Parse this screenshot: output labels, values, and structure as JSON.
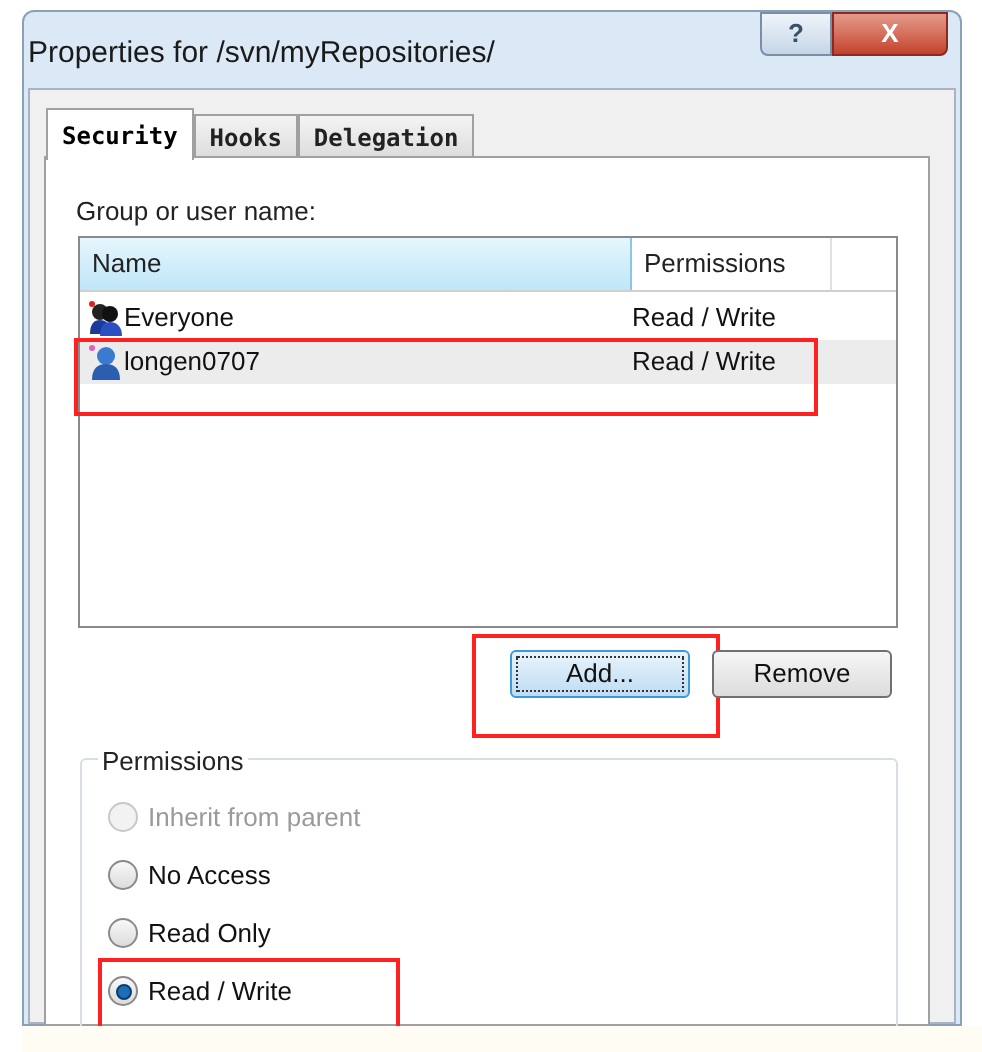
{
  "window": {
    "title": "Properties for /svn/myRepositories/",
    "buttons": [
      "?",
      "X"
    ]
  },
  "tabs": [
    {
      "label": "Security",
      "selected": true
    },
    {
      "label": "Hooks",
      "selected": false
    },
    {
      "label": "Delegation",
      "selected": false
    }
  ],
  "group_label": "Group or user name:",
  "table": {
    "columns": [
      "Name",
      "Permissions"
    ],
    "rows": [
      {
        "name": "Everyone",
        "permissions": "Read / Write",
        "kind": "group",
        "selected": false,
        "highlighted": false
      },
      {
        "name": "longen0707",
        "permissions": "Read / Write",
        "kind": "user",
        "selected": true,
        "highlighted": true
      }
    ]
  },
  "buttons": [
    {
      "label": "Add...",
      "focused": true,
      "highlighted": true
    },
    {
      "label": "Remove",
      "focused": false,
      "highlighted": false
    }
  ],
  "permissions": {
    "title": "Permissions",
    "options": [
      {
        "label": "Inherit from parent",
        "selected": false,
        "disabled": true,
        "highlighted": false
      },
      {
        "label": "No Access",
        "selected": false,
        "disabled": false,
        "highlighted": false
      },
      {
        "label": "Read Only",
        "selected": false,
        "disabled": false,
        "highlighted": false
      },
      {
        "label": "Read / Write",
        "selected": true,
        "disabled": false,
        "highlighted": true
      }
    ]
  }
}
